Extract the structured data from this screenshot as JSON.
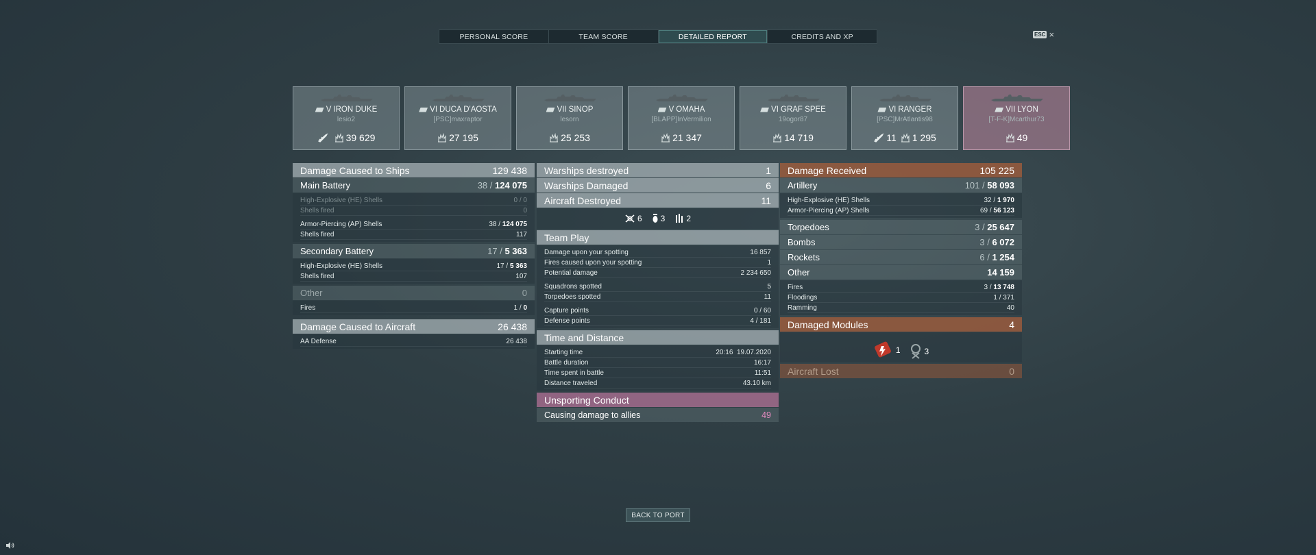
{
  "tabs": [
    {
      "label": "PERSONAL SCORE"
    },
    {
      "label": "TEAM SCORE"
    },
    {
      "label": "DETAILED REPORT",
      "active": true
    },
    {
      "label": "CREDITS AND XP"
    }
  ],
  "esc_label": "ESC",
  "ships": [
    {
      "tier": "V",
      "name": "IRON DUKE",
      "player": "lesio2",
      "plane": true,
      "plane_count": "",
      "damage": "39 629"
    },
    {
      "tier": "VI",
      "name": "DUCA D'AOSTA",
      "player": "[PSC]maxraptor",
      "plane": false,
      "plane_count": "",
      "damage": "27 195"
    },
    {
      "tier": "VII",
      "name": "SINOP",
      "player": "lesorn",
      "plane": false,
      "plane_count": "",
      "damage": "25 253"
    },
    {
      "tier": "V",
      "name": "OMAHA",
      "player": "[BLAPP]InVermilion",
      "plane": false,
      "plane_count": "",
      "damage": "21 347"
    },
    {
      "tier": "VI",
      "name": "GRAF SPEE",
      "player": "19ogor87",
      "plane": false,
      "plane_count": "",
      "damage": "14 719"
    },
    {
      "tier": "VI",
      "name": "RANGER",
      "player": "[PSC]MrAtlantis98",
      "plane": true,
      "plane_count": "11",
      "damage": "1 295"
    },
    {
      "tier": "VII",
      "name": "LYON",
      "player": "[T-F-K]Mcarthur73",
      "plane": false,
      "plane_count": "",
      "damage": "49",
      "selected": true
    }
  ],
  "left": {
    "damage_ships": {
      "label": "Damage Caused to Ships",
      "value": "129 438"
    },
    "main_battery": {
      "label": "Main Battery",
      "hits": "38",
      "value": "124 075"
    },
    "mb_he": {
      "label": "High-Explosive (HE) Shells",
      "value": "0 / 0"
    },
    "mb_he_fired": {
      "label": "Shells fired",
      "value": "0"
    },
    "mb_ap": {
      "label": "Armor-Piercing (AP) Shells",
      "hits": "38",
      "value": "124 075"
    },
    "mb_ap_fired": {
      "label": "Shells fired",
      "value": "117"
    },
    "secondary": {
      "label": "Secondary Battery",
      "hits": "17",
      "value": "5 363"
    },
    "sec_he": {
      "label": "High-Explosive (HE) Shells",
      "hits": "17",
      "value": "5 363"
    },
    "sec_fired": {
      "label": "Shells fired",
      "value": "107"
    },
    "other": {
      "label": "Other",
      "value": "0"
    },
    "fires": {
      "label": "Fires",
      "hits": "1",
      "value": "0"
    },
    "damage_aircraft": {
      "label": "Damage Caused to Aircraft",
      "value": "26 438"
    },
    "aa": {
      "label": "AA Defense",
      "value": "26 438"
    }
  },
  "middle": {
    "warships_destroyed": {
      "label": "Warships destroyed",
      "value": "1"
    },
    "warships_damaged": {
      "label": "Warships Damaged",
      "value": "6"
    },
    "aircraft_destroyed": {
      "label": "Aircraft Destroyed",
      "value": "11"
    },
    "aircraft_icons": {
      "fighters": "6",
      "bombers": "3",
      "torpedo": "2"
    },
    "team_play": {
      "label": "Team Play"
    },
    "tp_rows": [
      {
        "label": "Damage upon your spotting",
        "value": "16 857"
      },
      {
        "label": "Fires caused upon your spotting",
        "value": "1"
      },
      {
        "label": "Potential damage",
        "value": "2 234 650"
      }
    ],
    "tp_rows2": [
      {
        "label": "Squadrons spotted",
        "value": "5"
      },
      {
        "label": "Torpedoes spotted",
        "value": "11"
      }
    ],
    "tp_rows3": [
      {
        "label": "Capture points",
        "value": "0 / 60"
      },
      {
        "label": "Defense points",
        "value": "4 / 181"
      }
    ],
    "time_distance": {
      "label": "Time and Distance"
    },
    "td_rows": [
      {
        "label": "Starting time",
        "value": "20:16  19.07.2020"
      },
      {
        "label": "Battle duration",
        "value": "16:17"
      },
      {
        "label": "Time spent in battle",
        "value": "11:51"
      },
      {
        "label": "Distance traveled",
        "value": "43.10 km"
      }
    ],
    "unsporting": {
      "label": "Unsporting Conduct"
    },
    "allies_damage": {
      "label": "Causing damage to allies",
      "value": "49"
    }
  },
  "right": {
    "damage_received": {
      "label": "Damage Received",
      "value": "105 225"
    },
    "artillery": {
      "label": "Artillery",
      "hits": "101",
      "value": "58 093"
    },
    "art_he": {
      "label": "High-Explosive (HE) Shells",
      "hits": "32",
      "value": "1 970"
    },
    "art_ap": {
      "label": "Armor-Piercing (AP) Shells",
      "hits": "69",
      "value": "56 123"
    },
    "torpedoes": {
      "label": "Torpedoes",
      "hits": "3",
      "value": "25 647"
    },
    "bombs": {
      "label": "Bombs",
      "hits": "3",
      "value": "6 072"
    },
    "rockets": {
      "label": "Rockets",
      "hits": "6",
      "value": "1 254"
    },
    "other": {
      "label": "Other",
      "value": "14 159"
    },
    "fires": {
      "label": "Fires",
      "hits": "3",
      "value": "13 748"
    },
    "floodings": {
      "label": "Floodings",
      "value": "1 / 371"
    },
    "ramming": {
      "label": "Ramming",
      "value": "40"
    },
    "damaged_modules": {
      "label": "Damaged Modules",
      "value": "4"
    },
    "module_icons": {
      "engine": "1",
      "steering": "3"
    },
    "aircraft_lost": {
      "label": "Aircraft Lost",
      "value": "0"
    }
  },
  "back_button": "BACK TO PORT",
  "colors": {
    "accent_active": "#2f4b4f",
    "orange": "#a05c3c",
    "pink": "#aa6e91",
    "pink_text": "#e58bc0"
  }
}
